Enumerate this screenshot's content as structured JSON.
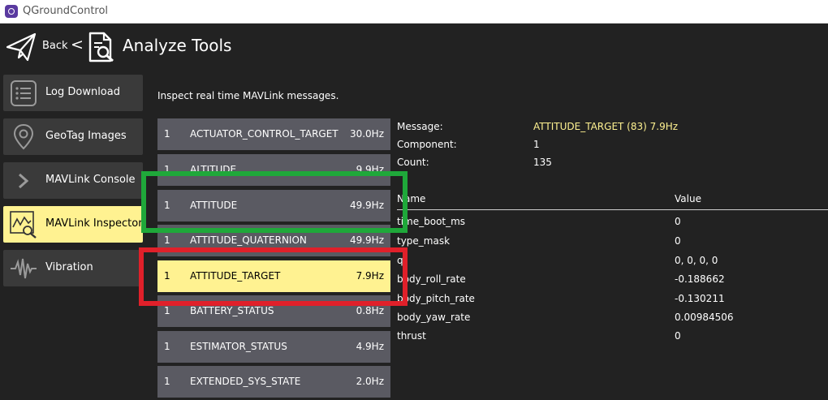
{
  "window": {
    "title": "QGroundControl"
  },
  "header": {
    "back_label": "Back",
    "separator": "<",
    "page_title": "Analyze Tools"
  },
  "sidebar": {
    "items": [
      {
        "label": "Log Download",
        "icon": "list-icon",
        "active": false
      },
      {
        "label": "GeoTag Images",
        "icon": "location-pin-icon",
        "active": false
      },
      {
        "label": "MAVLink Console",
        "icon": "chevron-right-icon",
        "active": false
      },
      {
        "label": "MAVLink Inspector",
        "icon": "chart-magnify-icon",
        "active": true
      },
      {
        "label": "Vibration",
        "icon": "waveform-icon",
        "active": false
      }
    ]
  },
  "main": {
    "description": "Inspect real time MAVLink messages.",
    "messages": [
      {
        "component": "1",
        "name": "ACTUATOR_CONTROL_TARGET",
        "rate": "30.0Hz",
        "selected": false
      },
      {
        "component": "1",
        "name": "ALTITUDE",
        "rate": "9.9Hz",
        "selected": false
      },
      {
        "component": "1",
        "name": "ATTITUDE",
        "rate": "49.9Hz",
        "selected": false
      },
      {
        "component": "1",
        "name": "ATTITUDE_QUATERNION",
        "rate": "49.9Hz",
        "selected": false
      },
      {
        "component": "1",
        "name": "ATTITUDE_TARGET",
        "rate": "7.9Hz",
        "selected": true
      },
      {
        "component": "1",
        "name": "BATTERY_STATUS",
        "rate": "0.8Hz",
        "selected": false
      },
      {
        "component": "1",
        "name": "ESTIMATOR_STATUS",
        "rate": "4.9Hz",
        "selected": false
      },
      {
        "component": "1",
        "name": "EXTENDED_SYS_STATE",
        "rate": "2.0Hz",
        "selected": false
      }
    ],
    "detail": {
      "message_label": "Message:",
      "message_value": "ATTITUDE_TARGET (83) 7.9Hz",
      "component_label": "Component:",
      "component_value": "1",
      "count_label": "Count:",
      "count_value": "135",
      "col_name": "Name",
      "col_value": "Value",
      "fields": [
        {
          "name": "time_boot_ms",
          "value": "0"
        },
        {
          "name": "type_mask",
          "value": "0"
        },
        {
          "name": "q",
          "value": "0, 0, 0, 0"
        },
        {
          "name": "body_roll_rate",
          "value": "-0.188662"
        },
        {
          "name": "body_pitch_rate",
          "value": "-0.130211"
        },
        {
          "name": "body_yaw_rate",
          "value": "0.00984506"
        },
        {
          "name": "thrust",
          "value": "0"
        }
      ]
    }
  },
  "colors": {
    "background": "#222222",
    "selected": "#fff291",
    "list_row": "#5a5a62",
    "highlight_green": "#1fa83a",
    "highlight_red": "#e0202a"
  }
}
